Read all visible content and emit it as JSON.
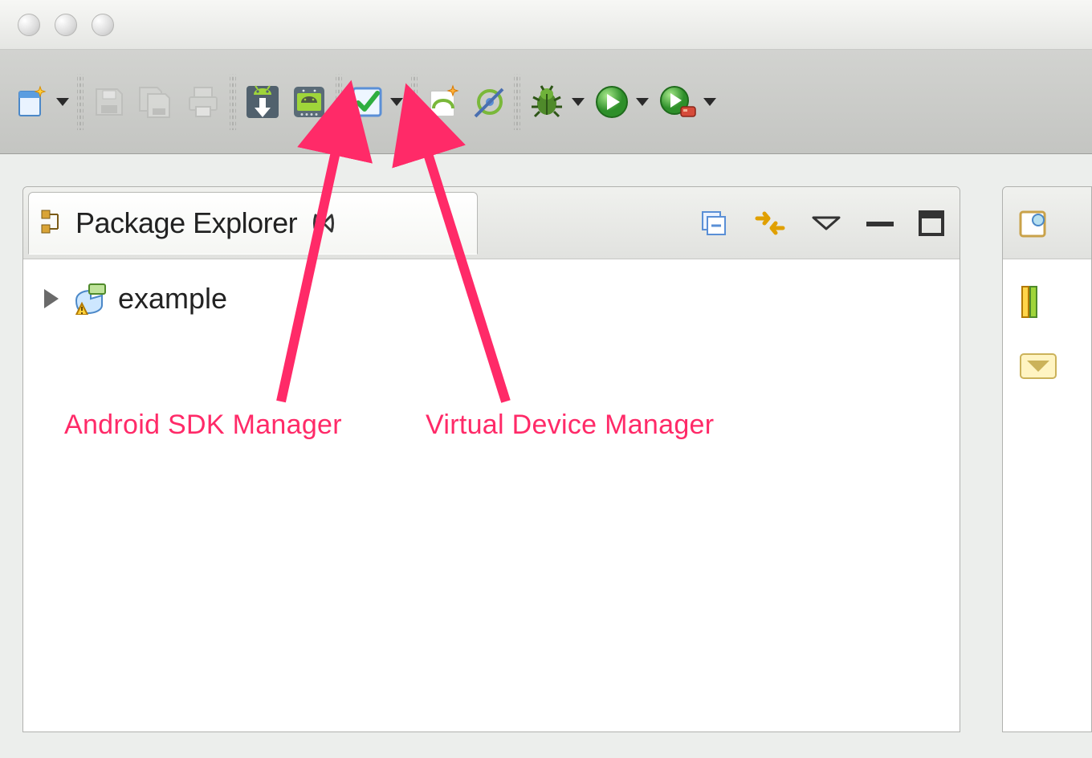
{
  "window": {
    "platform": "mac",
    "traffic_lights": [
      "close",
      "minimize",
      "zoom"
    ]
  },
  "toolbar": {
    "groups": [
      {
        "items": [
          {
            "id": "new-wizard",
            "icon": "new-file-sparkle-icon",
            "dropdown": true
          }
        ]
      },
      {
        "items": [
          {
            "id": "save",
            "icon": "save-icon",
            "disabled": true
          },
          {
            "id": "save-all",
            "icon": "save-all-icon",
            "disabled": true
          },
          {
            "id": "print",
            "icon": "print-icon",
            "disabled": true
          }
        ]
      },
      {
        "items": [
          {
            "id": "sdk-manager",
            "icon": "android-sdk-icon"
          },
          {
            "id": "avd-manager",
            "icon": "android-avd-icon"
          }
        ]
      },
      {
        "items": [
          {
            "id": "checkbox-todo",
            "icon": "check-box-icon",
            "dropdown": true
          }
        ]
      },
      {
        "items": [
          {
            "id": "new-android-project",
            "icon": "android-project-icon"
          },
          {
            "id": "lint",
            "icon": "lint-wand-icon"
          }
        ]
      },
      {
        "items": [
          {
            "id": "debug",
            "icon": "bug-icon",
            "dropdown": true
          },
          {
            "id": "run",
            "icon": "play-icon",
            "dropdown": true
          },
          {
            "id": "run-external",
            "icon": "play-external-icon",
            "dropdown": true
          }
        ]
      }
    ]
  },
  "panel": {
    "title": "Package Explorer",
    "tree": {
      "items": [
        {
          "label": "example",
          "expanded": false
        }
      ]
    },
    "view_menu_tools": [
      "collapse-all",
      "link-with-editor",
      "view-menu",
      "minimize",
      "maximize"
    ]
  },
  "annotations": {
    "sdk": "Android SDK Manager",
    "avd": "Virtual Device Manager"
  }
}
